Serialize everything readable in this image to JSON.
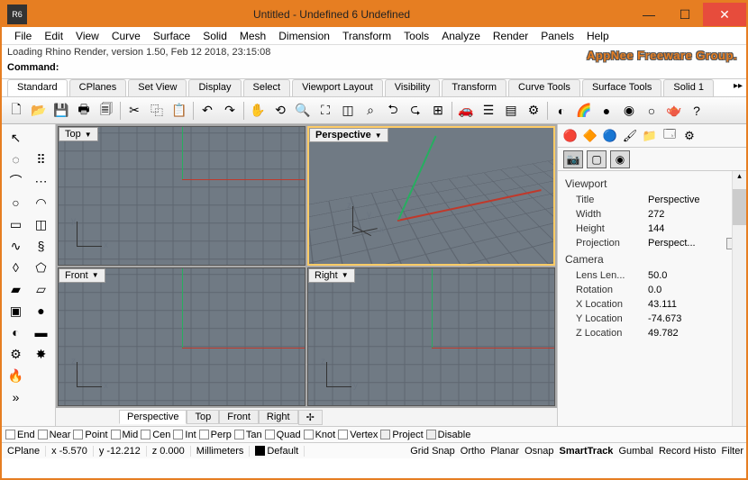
{
  "window": {
    "title": "Untitled - Undefined 6 Undefined",
    "app_icon_label": "R6"
  },
  "menu": [
    "File",
    "Edit",
    "View",
    "Curve",
    "Surface",
    "Solid",
    "Mesh",
    "Dimension",
    "Transform",
    "Tools",
    "Analyze",
    "Render",
    "Panels",
    "Help"
  ],
  "command_area": {
    "loading_line": "Loading Rhino Render, version 1.50, Feb 12 2018, 23:15:08",
    "command_label": "Command:",
    "watermark": "AppNee Freeware Group."
  },
  "toolbar_tabs": [
    "Standard",
    "CPlanes",
    "Set View",
    "Display",
    "Select",
    "Viewport Layout",
    "Visibility",
    "Transform",
    "Curve Tools",
    "Surface Tools",
    "Solid 1"
  ],
  "toolbar_tabs_scroll": "▸▸",
  "toolbar_icons": [
    "new",
    "open",
    "save",
    "print",
    "doc",
    "cut",
    "copy",
    "paste",
    "undo",
    "redo",
    "hand",
    "rotate-view",
    "zoom",
    "zoom-extents",
    "zoom-sel",
    "zoom-win",
    "undo-view",
    "redo-view",
    "grid-4",
    "car",
    "layers",
    "layers2",
    "props",
    "render",
    "rainbow",
    "shade",
    "sphere",
    "sphere2",
    "teapot",
    "help"
  ],
  "left_tools": [
    "pointer",
    "",
    "lasso",
    "select-pts",
    "polyline",
    "pts",
    "circle",
    "arc",
    "rect",
    "rect2",
    "curve",
    "helix",
    "text",
    "text2",
    "surface1",
    "surface2",
    "box",
    "sphere",
    "revolve",
    "extrude",
    "gear",
    "explode",
    "flame",
    "",
    "right-arrow",
    ""
  ],
  "viewports": {
    "top": {
      "label": "Top"
    },
    "perspective": {
      "label": "Perspective"
    },
    "front": {
      "label": "Front"
    },
    "right": {
      "label": "Right"
    }
  },
  "axis_labels": {
    "x": "x",
    "y": "y",
    "z": "z"
  },
  "viewport_tabs": [
    "Perspective",
    "Top",
    "Front",
    "Right"
  ],
  "viewport_tabs_add": "✢",
  "right_panel": {
    "top_icons": [
      "globe",
      "hat",
      "sphere",
      "brush",
      "folder",
      "window",
      "gear"
    ],
    "sub_icons": [
      "camera",
      "wireframe",
      "shaded"
    ],
    "viewport_section": "Viewport",
    "camera_section": "Camera",
    "props": {
      "title_k": "Title",
      "title_v": "Perspective",
      "width_k": "Width",
      "width_v": "272",
      "height_k": "Height",
      "height_v": "144",
      "proj_k": "Projection",
      "proj_v": "Perspect...",
      "lens_k": "Lens Len...",
      "lens_v": "50.0",
      "rot_k": "Rotation",
      "rot_v": "0.0",
      "xloc_k": "X Location",
      "xloc_v": "43.111",
      "yloc_k": "Y Location",
      "yloc_v": "-74.673",
      "zloc_k": "Z Location",
      "zloc_v": "49.782"
    }
  },
  "osnaps": [
    "End",
    "Near",
    "Point",
    "Mid",
    "Cen",
    "Int",
    "Perp",
    "Tan",
    "Quad",
    "Knot",
    "Vertex",
    "Project",
    "Disable"
  ],
  "status": {
    "cplane": "CPlane",
    "x": "x -5.570",
    "y": "y -12.212",
    "z": "z 0.000",
    "units": "Millimeters",
    "default": "Default",
    "toggles": [
      "Grid Snap",
      "Ortho",
      "Planar",
      "Osnap",
      "SmartTrack",
      "Gumbal",
      "Record Histo",
      "Filter"
    ],
    "active_toggle": "SmartTrack"
  }
}
